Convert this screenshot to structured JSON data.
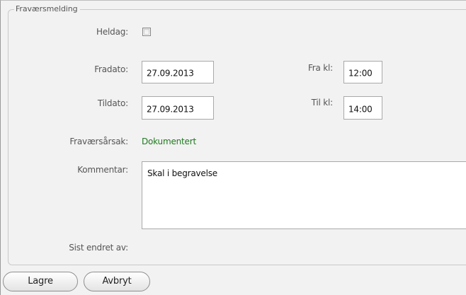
{
  "form": {
    "legend": "Fraværsmelding",
    "heldag": {
      "label": "Heldag:",
      "checked": false
    },
    "fradato": {
      "label": "Fradato:",
      "value": "27.09.2013"
    },
    "frakl": {
      "label": "Fra kl:",
      "value": "12:00"
    },
    "tildato": {
      "label": "Tildato:",
      "value": "27.09.2013"
    },
    "tilkl": {
      "label": "Til kl:",
      "value": "14:00"
    },
    "arsak": {
      "label": "Fraværsårsak:",
      "value": "Dokumentert"
    },
    "kommentar": {
      "label": "Kommentar:",
      "value": "Skal i begravelse"
    },
    "sist_endret": {
      "label": "Sist endret av:",
      "value": ""
    }
  },
  "buttons": {
    "save": "Lagre",
    "cancel": "Avbryt"
  },
  "colors": {
    "status_green": "#1f7a1f",
    "background": "#f2f2f2"
  }
}
